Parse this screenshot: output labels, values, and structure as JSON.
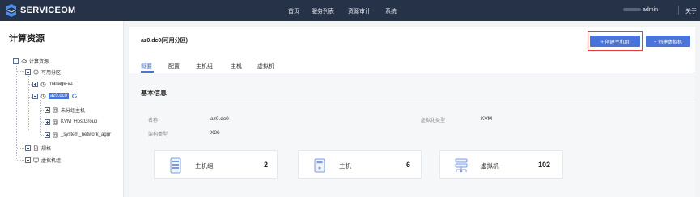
{
  "app": {
    "name": "SERVICEOM"
  },
  "nav": {
    "items": [
      "首页",
      "服务列表",
      "资源审计",
      "系统"
    ]
  },
  "user": {
    "name": "admin",
    "about": "关于"
  },
  "sidebar": {
    "title": "计算资源",
    "tree": {
      "root": "计算资源",
      "az_group": "可用分区",
      "az_manage": "manage-az",
      "az_selected": "az0.dc0",
      "host_groups": [
        "未分组主机",
        "KVM_HostGroup",
        "_system_network_aggr"
      ],
      "spec": "规格",
      "vm_group": "虚拟机组"
    }
  },
  "main": {
    "title": "az0.dc0(可用分区)",
    "buttons": {
      "create_host_group": "+ 创建主机组",
      "create_vm": "+ 创建虚拟机"
    },
    "tabs": [
      "概要",
      "配置",
      "主机组",
      "主机",
      "虚拟机"
    ],
    "active_tab": "概要",
    "basic_info": {
      "title": "基本信息",
      "fields": [
        {
          "label": "名称",
          "value": "az0.dc0"
        },
        {
          "label": "虚拟化类型",
          "value": "KVM"
        },
        {
          "label": "架构类型",
          "value": "X86"
        }
      ]
    },
    "stats": [
      {
        "label": "主机组",
        "count": "2"
      },
      {
        "label": "主机",
        "count": "6"
      },
      {
        "label": "虚拟机",
        "count": "102"
      }
    ]
  },
  "colors": {
    "topbar": "#263247",
    "accent": "#4a74d9",
    "highlight": "#e83b3b"
  }
}
